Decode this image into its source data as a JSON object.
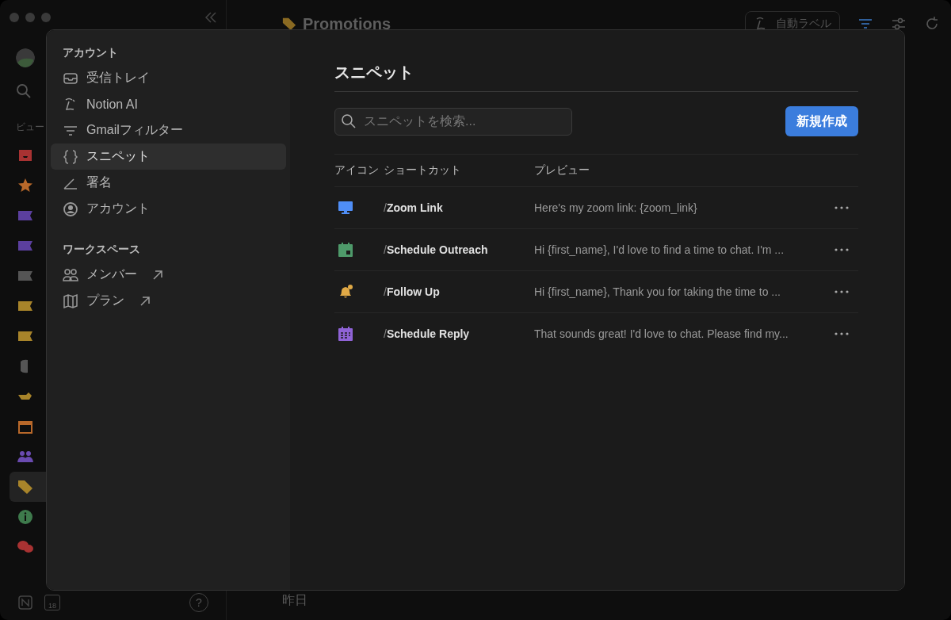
{
  "sidebar": {
    "section": "ビュー",
    "items": [
      {
        "kind": "inbox",
        "color": "#a83232",
        "selected": false
      },
      {
        "kind": "star",
        "color": "#b8682a",
        "selected": false
      },
      {
        "kind": "label",
        "color": "#5b3f9e",
        "selected": false
      },
      {
        "kind": "label",
        "color": "#5b3f9e",
        "selected": false
      },
      {
        "kind": "label",
        "color": "#555555",
        "selected": false
      },
      {
        "kind": "label",
        "color": "#a8842a",
        "selected": false
      },
      {
        "kind": "label",
        "color": "#a8842a",
        "selected": false
      },
      {
        "kind": "note",
        "color": "#555555",
        "selected": false
      },
      {
        "kind": "hand",
        "color": "#a8842a",
        "selected": false
      },
      {
        "kind": "calendar",
        "color": "#b8682a",
        "selected": false
      },
      {
        "kind": "people",
        "color": "#6a4bb0",
        "selected": false
      },
      {
        "kind": "tag",
        "color": "#a8842a",
        "selected": true
      },
      {
        "kind": "info",
        "color": "#3e7a4c",
        "selected": false
      },
      {
        "kind": "chat",
        "color": "#a83232",
        "selected": false
      }
    ],
    "calendar_day": "18",
    "help": "?"
  },
  "main": {
    "title": "Promotions",
    "auto_label_button": "自動ラベル",
    "date_group": "昨日"
  },
  "settings": {
    "sections": [
      {
        "heading": "アカウント",
        "items": [
          {
            "kind": "inbox",
            "label": "受信トレイ",
            "selected": false,
            "external": false
          },
          {
            "kind": "ai",
            "label": "Notion AI",
            "selected": false,
            "external": false
          },
          {
            "kind": "filter",
            "label": "Gmailフィルター",
            "selected": false,
            "external": false
          },
          {
            "kind": "braces",
            "label": "スニペット",
            "selected": true,
            "external": false
          },
          {
            "kind": "pen",
            "label": "署名",
            "selected": false,
            "external": false
          },
          {
            "kind": "account",
            "label": "アカウント",
            "selected": false,
            "external": false
          }
        ]
      },
      {
        "heading": "ワークスペース",
        "items": [
          {
            "kind": "people",
            "label": "メンバー",
            "selected": false,
            "external": true
          },
          {
            "kind": "map",
            "label": "プラン",
            "selected": false,
            "external": true
          }
        ]
      }
    ],
    "page_title": "スニペット",
    "search": {
      "placeholder": "スニペットを検索..."
    },
    "new_button": "新規作成",
    "table": {
      "columns": [
        "アイコン",
        "ショートカット",
        "プレビュー"
      ],
      "rows": [
        {
          "kind": "monitor",
          "color": "#4f8ef7",
          "prefix": "/",
          "shortcut": "Zoom Link",
          "preview": "Here's my zoom link: {zoom_link}"
        },
        {
          "kind": "calendar",
          "color": "#4e9a6a",
          "prefix": "/",
          "shortcut": "Schedule Outreach",
          "preview": "Hi {first_name}, I'd love to find a time to chat. I'm ..."
        },
        {
          "kind": "bell",
          "color": "#e0a946",
          "prefix": "/",
          "shortcut": "Follow Up",
          "preview": "Hi {first_name}, Thank you for taking the time to ..."
        },
        {
          "kind": "calendar-grid",
          "color": "#8f63d6",
          "prefix": "/",
          "shortcut": "Schedule Reply",
          "preview": "That sounds great! I'd love to chat. Please find my..."
        }
      ]
    }
  }
}
